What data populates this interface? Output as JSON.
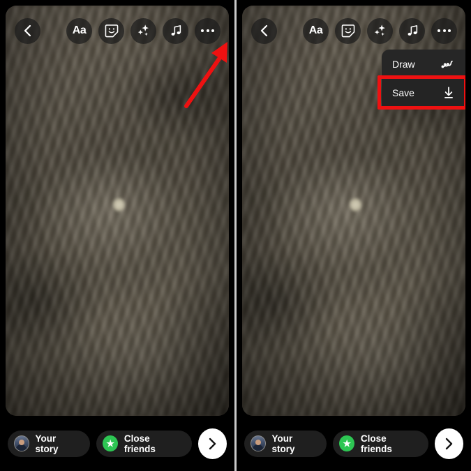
{
  "meta": {
    "app": "Instagram Story Editor",
    "screens": 2,
    "accent_red": "#ee1111",
    "close_friends_green": "#2dc653",
    "toolbar_bg": "rgba(28,28,28,0.72)",
    "menu_bg": "#262626"
  },
  "left_panel": {
    "toolbar": {
      "back_label": "Back",
      "back_icon": "chevron-left-icon",
      "actions": [
        {
          "label": "Aa",
          "name": "text-tool",
          "icon": "text-aa-icon"
        },
        {
          "label": "Sticker",
          "name": "sticker-tool",
          "icon": "sticker-smiley-icon"
        },
        {
          "label": "Effects",
          "name": "effects-tool",
          "icon": "sparkles-icon"
        },
        {
          "label": "Music",
          "name": "music-tool",
          "icon": "music-note-icon"
        },
        {
          "label": "More",
          "name": "more-options",
          "icon": "three-dots-icon"
        }
      ]
    },
    "annotation": {
      "type": "arrow",
      "color": "#ee1111",
      "points_to": "more-options"
    },
    "bottom_bar": {
      "your_story_label": "Your story",
      "close_friends_label": "Close friends",
      "next_label": "Next",
      "next_icon": "chevron-right-icon",
      "star_icon": "star-icon"
    }
  },
  "right_panel": {
    "toolbar": {
      "back_label": "Back",
      "back_icon": "chevron-left-icon",
      "actions": [
        {
          "label": "Aa",
          "name": "text-tool",
          "icon": "text-aa-icon"
        },
        {
          "label": "Sticker",
          "name": "sticker-tool",
          "icon": "sticker-smiley-icon"
        },
        {
          "label": "Effects",
          "name": "effects-tool",
          "icon": "sparkles-icon"
        },
        {
          "label": "Music",
          "name": "music-tool",
          "icon": "music-note-icon"
        },
        {
          "label": "More",
          "name": "more-options",
          "icon": "three-dots-icon"
        }
      ]
    },
    "menu": {
      "items": [
        {
          "label": "Draw",
          "icon": "scribble-icon",
          "highlighted": false
        },
        {
          "label": "Save",
          "icon": "download-icon",
          "highlighted": true
        }
      ]
    },
    "bottom_bar": {
      "your_story_label": "Your story",
      "close_friends_label": "Close friends",
      "next_label": "Next",
      "next_icon": "chevron-right-icon",
      "star_icon": "star-icon"
    }
  }
}
